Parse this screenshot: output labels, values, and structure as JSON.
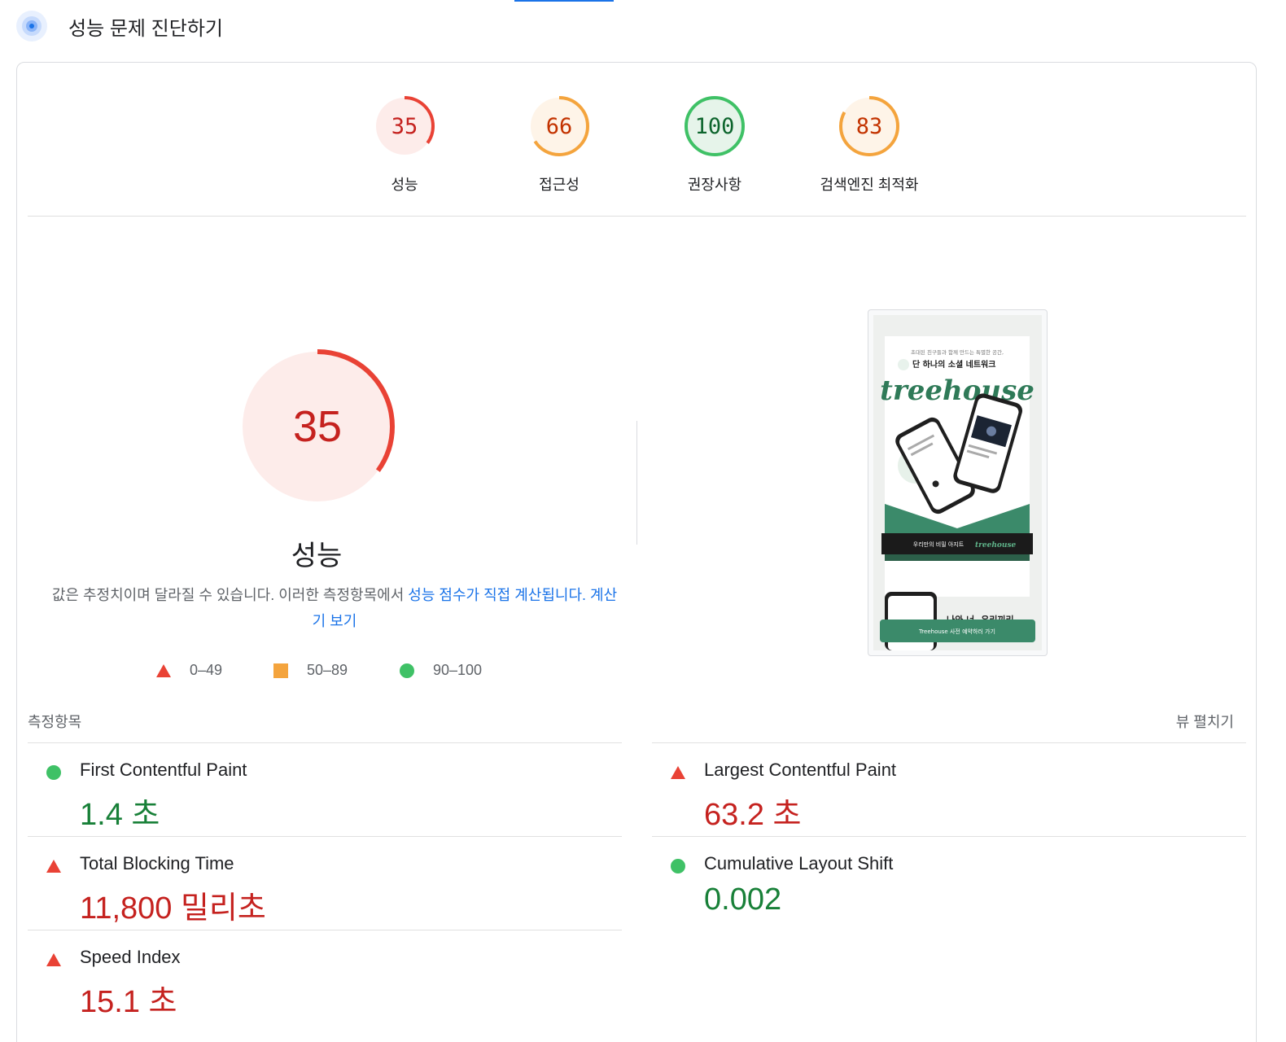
{
  "header": {
    "title": "성능 문제 진단하기",
    "icon": "speedometer-icon"
  },
  "gauges": [
    {
      "score": "35",
      "label": "성능",
      "fraction": 0.35,
      "status": "fail"
    },
    {
      "score": "66",
      "label": "접근성",
      "fraction": 0.66,
      "status": "average"
    },
    {
      "score": "100",
      "label": "권장사항",
      "fraction": 1.0,
      "status": "pass"
    },
    {
      "score": "83",
      "label": "검색엔진 최적화",
      "fraction": 0.83,
      "status": "average"
    }
  ],
  "performance": {
    "score": "35",
    "fraction": 0.35,
    "title": "성능",
    "desc_text": "값은 추정치이며 달라질 수 있습니다. 이러한 측정항목에서 ",
    "desc_link": "성능 점수가 직접 계산됩니다.",
    "calc_link": "계산기 보기"
  },
  "legend": [
    {
      "range": "0–49",
      "shape": "triangle",
      "color": "#e94235"
    },
    {
      "range": "50–89",
      "shape": "square",
      "color": "#f4a43d"
    },
    {
      "range": "90–100",
      "shape": "circle",
      "color": "#3fc166"
    }
  ],
  "screenshot": {
    "tagline": "초대된 친구들과 함께 만드는 특별한 공간,",
    "headline": "단 하나의 소셜 네트워크",
    "brand": "treehouse",
    "banner": "우리만의 비밀 아지트",
    "section": "나와 너, 우리끼리",
    "cta": "Treehouse 사전 예약하러 가기"
  },
  "metrics_section": {
    "label": "측정항목",
    "expand": "뷰 펼치기"
  },
  "metrics": [
    {
      "name": "First Contentful Paint",
      "value": "1.4 초",
      "status": "pass"
    },
    {
      "name": "Largest Contentful Paint",
      "value": "63.2 초",
      "status": "fail"
    },
    {
      "name": "Total Blocking Time",
      "value": "11,800 밀리초",
      "status": "fail"
    },
    {
      "name": "Cumulative Layout Shift",
      "value": "0.002",
      "status": "pass"
    },
    {
      "name": "Speed Index",
      "value": "15.1 초",
      "status": "fail"
    }
  ],
  "colors": {
    "fail": "#e94235",
    "fail_bg": "#fdecea",
    "fail_text": "#c5221f",
    "average": "#f4a43d",
    "average_bg": "#fef4e8",
    "average_text": "#c33300",
    "pass": "#3fc166",
    "pass_bg": "#e6f4ea",
    "pass_text": "#0d652d",
    "accent": "#1a73e8",
    "brand_green": "#3b8a6a"
  }
}
